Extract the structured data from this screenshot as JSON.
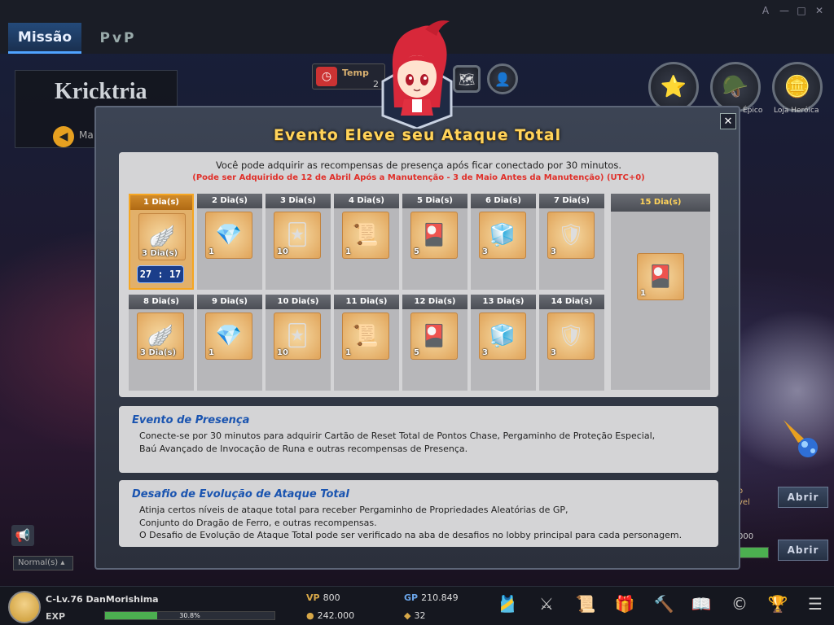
{
  "window": {
    "controls": [
      "A",
      "—",
      "□",
      "✕"
    ]
  },
  "tabs": [
    {
      "label": "Missão",
      "active": true
    },
    {
      "label": "PvP",
      "active": false
    }
  ],
  "left_panel": {
    "name": "Kricktria",
    "map_label": "Ma"
  },
  "timer_box": {
    "label": "Temp",
    "value": "2"
  },
  "top_right": {
    "icons": [
      "star-icon",
      "helmet-icon",
      "coin-icon"
    ],
    "labels": [
      "Épico",
      "Loja Heróica"
    ]
  },
  "modal": {
    "title": "Evento Eleve seu Ataque Total",
    "close_symbol": "✕",
    "intro": "Você pode adquirir as recompensas de presença após ficar conectado por 30 minutos.",
    "intro_red": "(Pode ser Adquirido de 12 de Abril Após a Manutenção - 3 de Maio Antes da Manutenção) (UTC+0)",
    "days": [
      {
        "label": "1 Dia(s)",
        "qty": "3 Dia(s)",
        "icon": "gc-wings-icon",
        "glyph": "🪽",
        "current": true,
        "timer": "27 : 17"
      },
      {
        "label": "2 Dia(s)",
        "qty": "1",
        "icon": "level-up-crystal-icon",
        "glyph": "💎"
      },
      {
        "label": "3 Dia(s)",
        "qty": "10",
        "icon": "reset-card-icon",
        "glyph": "🃏"
      },
      {
        "label": "4 Dia(s)",
        "qty": "1",
        "icon": "scroll-icon",
        "glyph": "📜"
      },
      {
        "label": "5 Dia(s)",
        "qty": "5",
        "icon": "gold-card-icon",
        "glyph": "🎴"
      },
      {
        "label": "6 Dia(s)",
        "qty": "3",
        "icon": "rune-chest-icon",
        "glyph": "🧊"
      },
      {
        "label": "7 Dia(s)",
        "qty": "3",
        "icon": "protection-scroll-icon",
        "glyph": "🛡"
      },
      {
        "label": "8 Dia(s)",
        "qty": "3 Dia(s)",
        "icon": "gc-wings-icon",
        "glyph": "🪽"
      },
      {
        "label": "9 Dia(s)",
        "qty": "1",
        "icon": "level-up-crystal-icon",
        "glyph": "💎"
      },
      {
        "label": "10 Dia(s)",
        "qty": "10",
        "icon": "reset-card-icon",
        "glyph": "🃏"
      },
      {
        "label": "11 Dia(s)",
        "qty": "1",
        "icon": "scroll-icon",
        "glyph": "📜"
      },
      {
        "label": "12 Dia(s)",
        "qty": "5",
        "icon": "gold-card-icon",
        "glyph": "🎴"
      },
      {
        "label": "13 Dia(s)",
        "qty": "3",
        "icon": "rune-chest-icon",
        "glyph": "🧊"
      },
      {
        "label": "14 Dia(s)",
        "qty": "3",
        "icon": "protection-scroll-icon",
        "glyph": "🛡"
      }
    ],
    "big_day": {
      "label": "15 Dia(s)",
      "qty": "1",
      "icon": "gold-card-icon",
      "glyph": "🎴"
    },
    "info1": {
      "title": "Evento de Presença",
      "lines": [
        "Conecte-se por 30 minutos para adquirir Cartão de Reset Total de Pontos Chase, Pergaminho de Proteção Especial,",
        "Baú Avançado de Invocação de Runa e outras recompensas de Presença."
      ]
    },
    "info2": {
      "title": "Desafio de Evolução de Ataque Total",
      "lines": [
        "Atinja certos níveis de ataque total para receber Pergaminho de Propriedades Aleatórias de GP,",
        "Conjunto do Dragão de Ferro, e outras recompensas.",
        "O Desafio de Evolução de Ataque Total pode ser verificado na aba de desafios no lobby principal para cada personagem."
      ]
    }
  },
  "side": {
    "abrir1": "Abrir",
    "abrir2": "Abrir",
    "frag1": "o",
    "frag2": "vel",
    "frag3": "000"
  },
  "chat": {
    "channel": "Normal(s)"
  },
  "player": {
    "level": "C-Lv.76 DanMorishima",
    "exp_label": "EXP",
    "exp_percent": "30.8%",
    "exp_fraction": 0.308,
    "vp_label": "VP",
    "vp": "800",
    "gold": "242.000",
    "gp_label": "GP",
    "gp": "210.849",
    "gem": "32"
  },
  "bottom_icons": [
    "armor-icon",
    "swords-icon",
    "scroll-quest-icon",
    "gift-icon",
    "hammer-icon",
    "book-icon",
    "coin-shop-icon",
    "trophy-icon",
    "menu-icon"
  ]
}
